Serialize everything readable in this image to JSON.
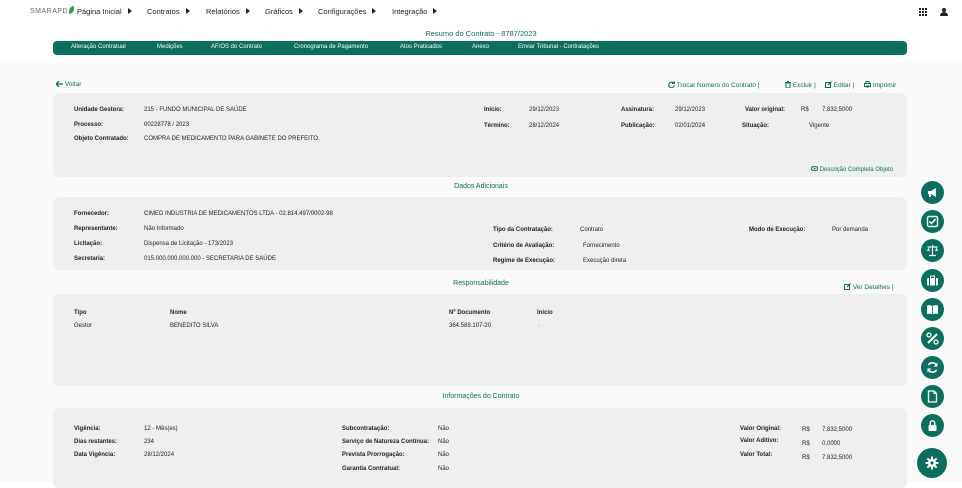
{
  "brand": {
    "logo_text": "SMARAPD"
  },
  "menu": [
    {
      "label": "Página Inicial"
    },
    {
      "label": "Contratos"
    },
    {
      "label": "Relatórios"
    },
    {
      "label": "Gráficos"
    },
    {
      "label": "Configurações"
    },
    {
      "label": "Integração"
    }
  ],
  "page": {
    "title": "Resumo do Contrato - 8787/2023"
  },
  "tabs": [
    {
      "label": "Alteração Contratual"
    },
    {
      "label": "Medições"
    },
    {
      "label": "AF/OS do Contrato"
    },
    {
      "label": "Cronograma de Pagamento"
    },
    {
      "label": "Atos Praticados"
    },
    {
      "label": "Anexo"
    },
    {
      "label": "Enviar Tribunal - Contratações"
    }
  ],
  "actions": {
    "back": "Voltar",
    "change_number": "Trocar Número do Contrato |",
    "delete": "Excluir |",
    "edit": "Editar |",
    "print": "Imprimir"
  },
  "summary": {
    "unidade_gestora_label": "Unidade Gestora:",
    "unidade_gestora": "215 - FUNDO MUNICIPAL DE SAÚDE",
    "processo_label": "Processo:",
    "processo": "00228778 / 2023",
    "objeto_label": "Objeto Contratado:",
    "objeto": "COMPRA DE MEDICAMENTO PARA GABINETE DO PREFEITO.",
    "inicio_label": "Início:",
    "inicio": "29/12/2023",
    "termino_label": "Término:",
    "termino": "28/12/2024",
    "assinatura_label": "Assinatura:",
    "assinatura": "29/12/2023",
    "publicacao_label": "Publicação:",
    "publicacao": "02/01/2024",
    "valor_original_label": "Valor original:",
    "currency": "R$",
    "valor_original": "7.832,5000",
    "situacao_label": "Situação:",
    "situacao": "Vigente",
    "desc_link": "Descrição Completa Objeto"
  },
  "dados": {
    "section_title": "Dados Adicionais",
    "fornecedor_label": "Fornecedor:",
    "fornecedor": "CIMED INDUSTRIA DE MEDICAMENTOS LTDA - 02.814.497/0002-98",
    "representante_label": "Representante:",
    "representante": "Não Informado",
    "licitacao_label": "Licitação:",
    "licitacao": "Dispensa de Licitação - 173/2023",
    "secretaria_label": "Secretaria:",
    "secretaria": "015.000.000.000.000 - SECRETARIA DE SAÚDE",
    "tipo_label": "Tipo da Contratação:",
    "tipo": "Contrato",
    "criterio_label": "Critério de Avaliação:",
    "criterio": "Fornecimento",
    "regime_label": "Regime de Execução:",
    "regime": "Execução direta",
    "modo_label": "Modo de Execução:",
    "modo": "Por demanda"
  },
  "responsabilidade": {
    "section_title": "Responsabilidade",
    "details_link": "Ver Detalhes |",
    "columns": [
      "Tipo",
      "Nome",
      "Nº Documento",
      "Início"
    ],
    "rows": [
      {
        "tipo": "Gestor",
        "nome": "BENEDITO SILVA",
        "documento": "364.589.107-20",
        "inicio": "-"
      }
    ]
  },
  "info": {
    "section_title": "Informações do Contrato",
    "vigencia_label": "Vigência:",
    "vigencia": "12 - Mês(es)",
    "dias_label": "Dias restantes:",
    "dias": "234",
    "data_vig_label": "Data Vigência:",
    "data_vig": "28/12/2024",
    "subcontratacao_label": "Subcontratação:",
    "subcontratacao": "Não",
    "servico_label": "Serviço de Natureza Contínua:",
    "servico": "Não",
    "prorrogacao_label": "Prevista Prorrogação:",
    "prorrogacao": "Não",
    "garantia_label": "Garantia Contratual:",
    "garantia": "Não",
    "valor_original_label": "Valor Original:",
    "valor_original": "7.832,5000",
    "valor_aditivo_label": "Valor Aditivo:",
    "valor_aditivo": "0,0000",
    "valor_total_label": "Valor Total:",
    "valor_total": "7.832,5000"
  },
  "sidebar_icons": [
    "megaphone-icon",
    "checkbox-icon",
    "scale-icon",
    "briefcase-icon",
    "book-icon",
    "tools-icon",
    "refresh-icon",
    "document-icon",
    "lock-icon",
    "gear-icon"
  ],
  "colors": {
    "accent": "#0b6e5e",
    "panel": "#efefef"
  }
}
